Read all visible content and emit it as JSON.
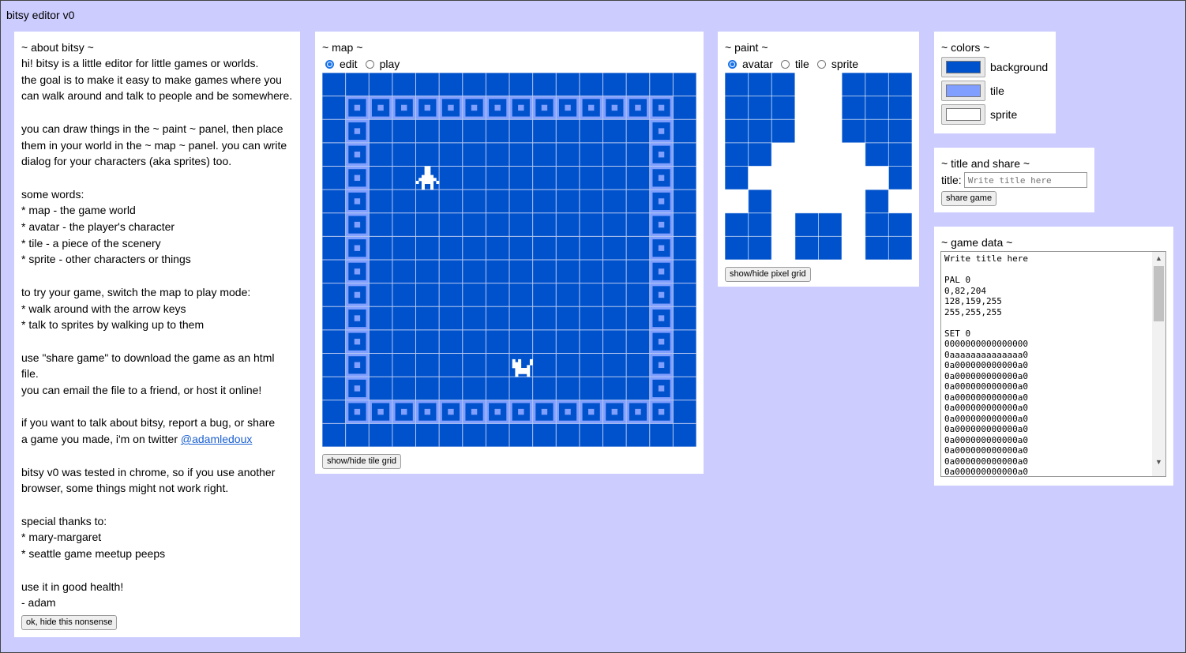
{
  "app": {
    "title": "bitsy editor v0"
  },
  "about": {
    "title": "~ about bitsy ~",
    "lines": [
      "hi! bitsy is a little editor for little games or worlds.",
      "the goal is to make it easy to make games where you",
      "can walk around and talk to people and be somewhere.",
      "",
      "you can draw things in the ~ paint ~ panel, then place",
      "them in your world in the ~ map ~ panel. you can write",
      "dialog for your characters (aka sprites) too.",
      "",
      "some words:",
      "* map - the game world",
      "* avatar - the player's character",
      "* tile - a piece of the scenery",
      "* sprite - other characters or things",
      "",
      "to try your game, switch the map to play mode:",
      "* walk around with the arrow keys",
      "* talk to sprites by walking up to them",
      "",
      "use \"share game\" to download the game as an html file.",
      "you can email the file to a friend, or host it online!",
      "",
      "if you want to talk about bitsy, report a bug, or share"
    ],
    "twitter_prefix": "a game you made, i'm on twitter ",
    "twitter_link": "@adamledoux",
    "lines_after": [
      "",
      "bitsy v0 was tested in chrome, so if you use another",
      "browser, some things might not work right.",
      "",
      "special thanks to:",
      "* mary-margaret",
      "* seattle game meetup peeps",
      "",
      "use it in good health!",
      "- adam"
    ],
    "hide_button": "ok, hide this nonsense"
  },
  "map": {
    "title": "~ map ~",
    "modes": [
      "edit",
      "play"
    ],
    "selected_mode": "edit",
    "grid_button": "show/hide tile grid",
    "tilemap": [
      "0000000000000000",
      "0aaaaaaaaaaaaaa0",
      "0a000000000000a0",
      "0a000000000000a0",
      "0a000000000000a0",
      "0a000000000000a0",
      "0a000000000000a0",
      "0a000000000000a0",
      "0a000000000000a0",
      "0a000000000000a0",
      "0a000000000000a0",
      "0a000000000000a0",
      "0a000000000000a0",
      "0a000000000000a0",
      "0aaaaaaaaaaaaaa0",
      "0000000000000000"
    ],
    "avatar_tile": [
      4,
      4
    ],
    "sprite_tile": [
      8,
      12
    ]
  },
  "paint": {
    "title": "~ paint ~",
    "types": [
      "avatar",
      "tile",
      "sprite"
    ],
    "selected_type": "avatar",
    "grid_button": "show/hide pixel grid",
    "pixels": [
      "00011000",
      "00011000",
      "00011000",
      "00111100",
      "01111110",
      "10111101",
      "00100100",
      "00100100"
    ]
  },
  "colors": {
    "title": "~ colors ~",
    "items": [
      {
        "label": "background",
        "color": "#0052cc"
      },
      {
        "label": "tile",
        "color": "#809fff"
      },
      {
        "label": "sprite",
        "color": "#ffffff"
      }
    ]
  },
  "share": {
    "title": "~ title and share ~",
    "field_label": "title:",
    "placeholder": "Write title here",
    "share_button": "share game"
  },
  "gamedata": {
    "title": "~ game data ~",
    "text": "Write title here\n\nPAL 0\n0,82,204\n128,159,255\n255,255,255\n\nSET 0\n0000000000000000\n0aaaaaaaaaaaaaa0\n0a000000000000a0\n0a000000000000a0\n0a000000000000a0\n0a000000000000a0\n0a000000000000a0\n0a000000000000a0\n0a000000000000a0\n0a000000000000a0\n0a000000000000a0\n0a000000000000a0\n0a000000000000a0"
  }
}
